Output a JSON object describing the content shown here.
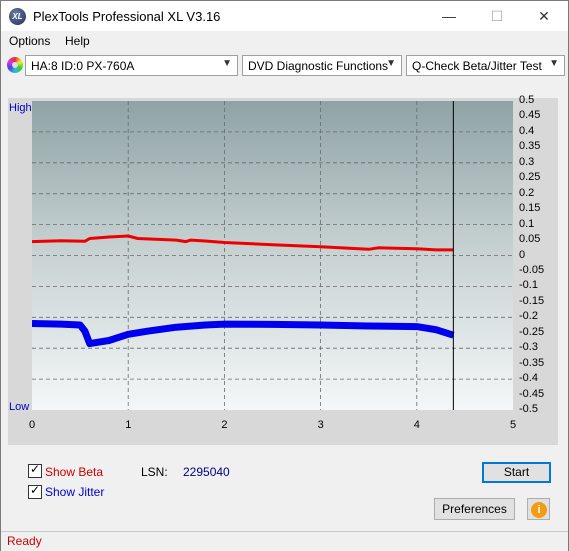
{
  "window": {
    "title": "PlexTools Professional XL V3.16"
  },
  "title_buttons": {
    "minimize": "—",
    "maximize": "☐",
    "close": "✕"
  },
  "menu": {
    "options": "Options",
    "help": "Help"
  },
  "toolbar": {
    "drive": "HA:8 ID:0  PX-760A",
    "function": "DVD Diagnostic Functions",
    "test": "Q-Check Beta/Jitter Test",
    "arrow": "▼"
  },
  "chart_data": {
    "type": "line",
    "left_axis_labels": {
      "top": "High",
      "bottom": "Low"
    },
    "x_ticks": [
      "0",
      "1",
      "2",
      "3",
      "4",
      "5"
    ],
    "xlim": [
      0,
      5
    ],
    "y_ticks": [
      "0.5",
      "0.45",
      "0.4",
      "0.35",
      "0.3",
      "0.25",
      "0.2",
      "0.15",
      "0.1",
      "0.05",
      "0",
      "-0.05",
      "-0.1",
      "-0.15",
      "-0.2",
      "-0.25",
      "-0.3",
      "-0.35",
      "-0.4",
      "-0.45",
      "-0.5"
    ],
    "ylim": [
      -0.5,
      0.5
    ],
    "grid": true,
    "marker_x": 4.38,
    "series": [
      {
        "color": "#ee0000",
        "x": [
          0,
          0.3,
          0.55,
          0.6,
          0.8,
          1.0,
          1.1,
          1.5,
          1.6,
          1.65,
          1.8,
          2.0,
          2.5,
          3.0,
          3.5,
          3.6,
          4.0,
          4.2,
          4.38
        ],
        "values": [
          0.045,
          0.048,
          0.046,
          0.055,
          0.06,
          0.063,
          0.055,
          0.05,
          0.045,
          0.05,
          0.047,
          0.042,
          0.035,
          0.028,
          0.02,
          0.025,
          0.022,
          0.018,
          0.018
        ]
      },
      {
        "color": "#0000ee",
        "x": [
          0,
          0.3,
          0.5,
          0.55,
          0.6,
          0.8,
          1.0,
          1.2,
          1.5,
          1.8,
          2.0,
          2.5,
          3.0,
          3.5,
          4.0,
          4.2,
          4.38
        ],
        "values": [
          -0.22,
          -0.222,
          -0.225,
          -0.245,
          -0.285,
          -0.275,
          -0.255,
          -0.245,
          -0.232,
          -0.225,
          -0.222,
          -0.223,
          -0.225,
          -0.228,
          -0.23,
          -0.24,
          -0.258
        ]
      }
    ]
  },
  "controls": {
    "show_beta": "Show Beta",
    "show_jitter": "Show Jitter",
    "lsn_label": "LSN:",
    "lsn_value": "2295040",
    "start": "Start",
    "preferences": "Preferences",
    "info": "i"
  },
  "status": {
    "text": "Ready"
  },
  "app_icon_text": "XL"
}
